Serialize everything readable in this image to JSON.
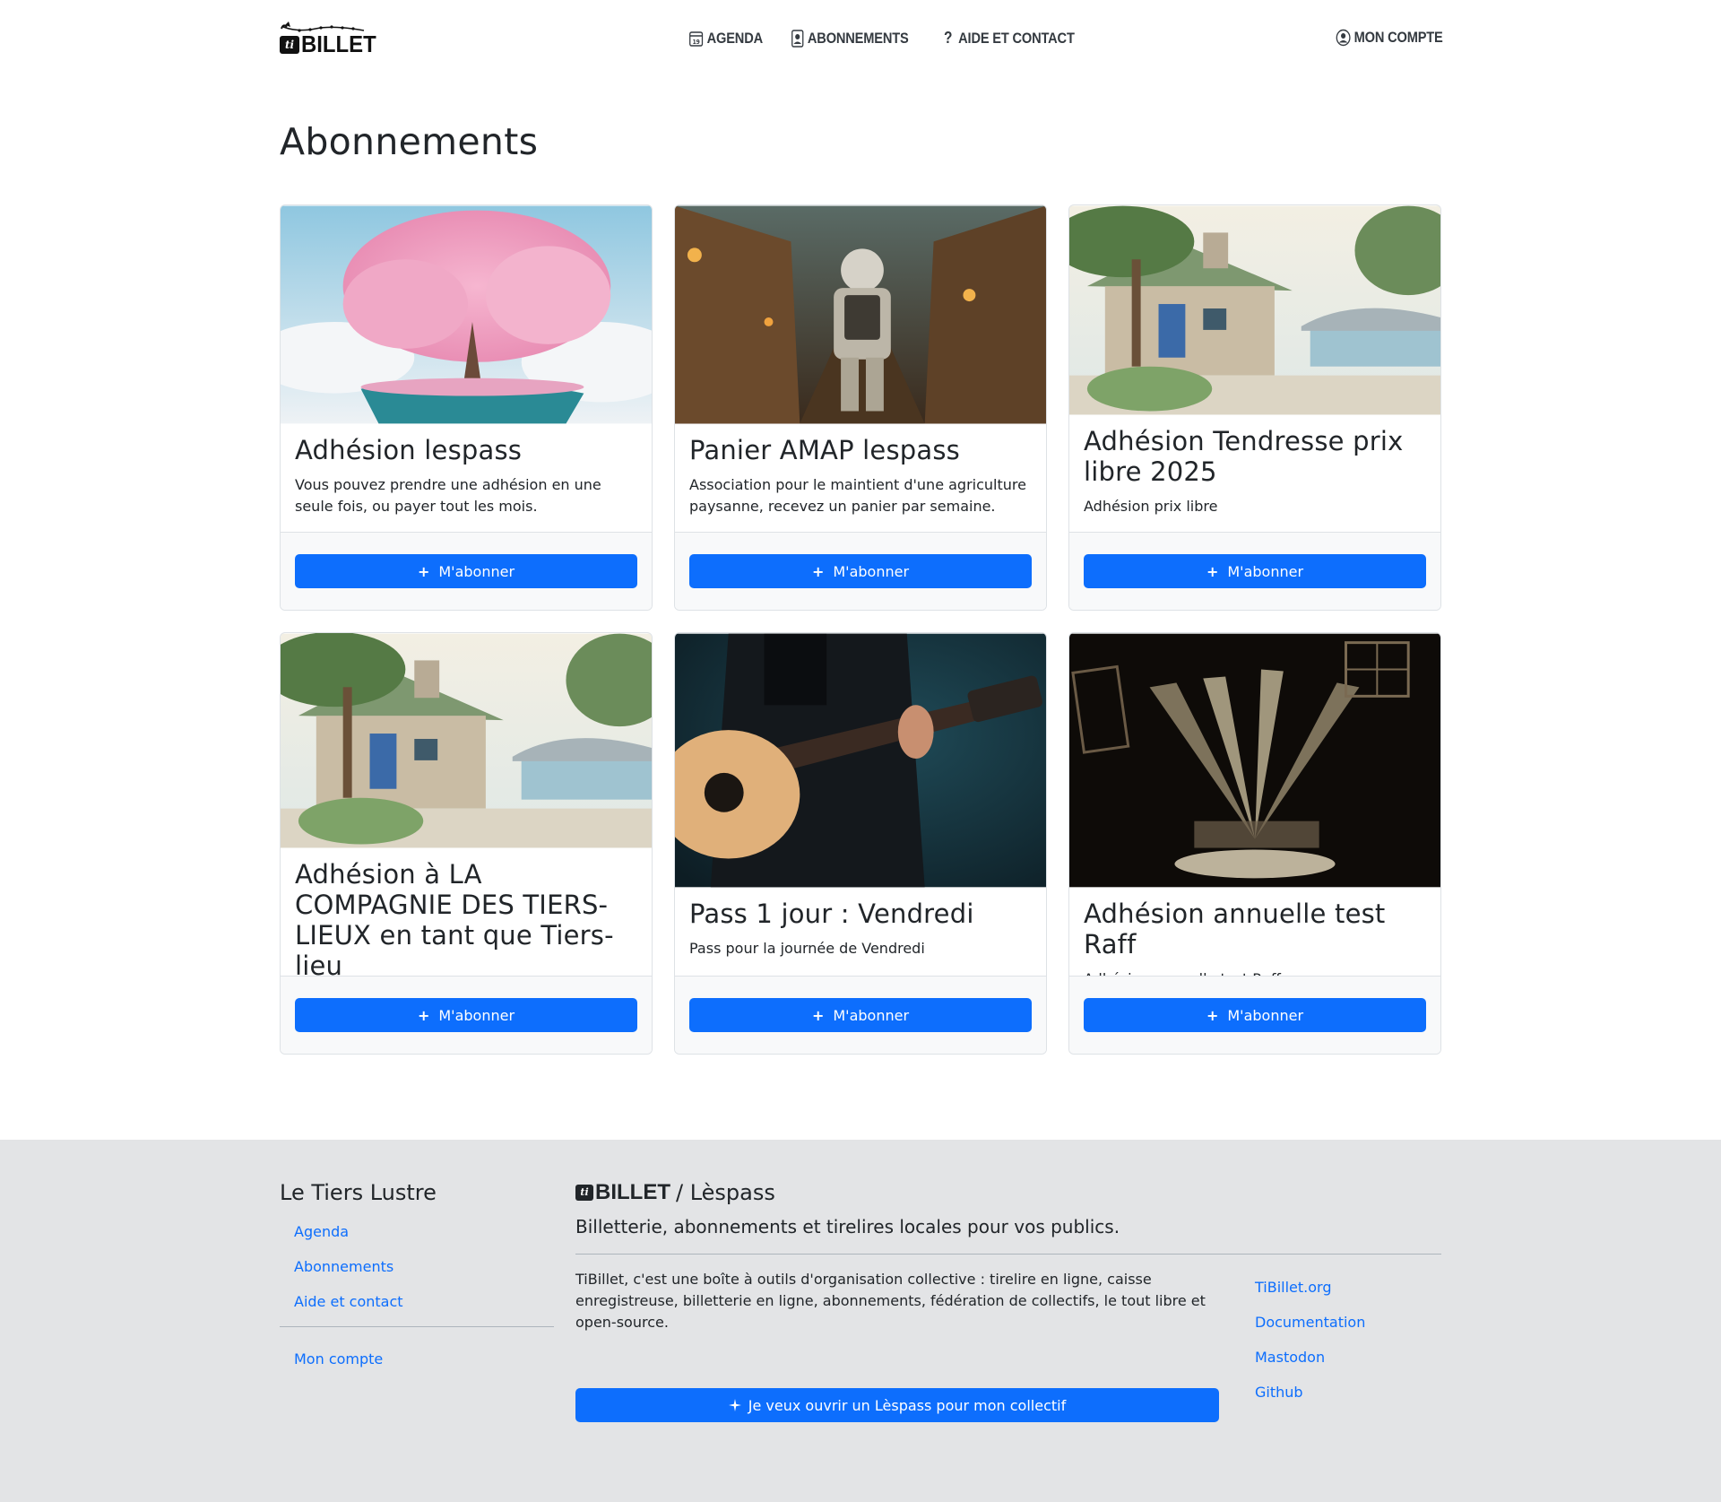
{
  "header": {
    "logo_text": "BILLET",
    "logo_ti": "ti",
    "nav": [
      {
        "label": "AGENDA",
        "icon": "calendar-icon"
      },
      {
        "label": "ABONNEMENTS",
        "icon": "badge-icon"
      },
      {
        "label": "AIDE ET CONTACT",
        "icon": "question-icon"
      }
    ],
    "account": {
      "label": "MON COMPTE",
      "icon": "user-circle-icon"
    }
  },
  "main": {
    "title": "Abonnements",
    "button_label": "M'abonner",
    "cards": [
      {
        "title": "Adhésion lespass",
        "text": "Vous pouvez prendre une adhésion en une seule fois, ou payer tout les mois.",
        "image": "cherry-blossom-tree-island"
      },
      {
        "title": "Panier AMAP lespass",
        "text": "Association pour le maintient d'une agriculture paysanne, recevez un panier par semaine.",
        "image": "astronaut-in-village-alley"
      },
      {
        "title": "Adhésion Tendresse prix libre 2025",
        "text": "Adhésion prix libre",
        "image": "stone-cottage-by-sea"
      },
      {
        "title": "Adhésion à LA COMPAGNIE DES TIERS-LIEUX en tant que Tiers-lieu",
        "text": "",
        "image": "stone-cottage-by-sea"
      },
      {
        "title": "Pass 1 jour : Vendredi",
        "text": "Pass pour la journée de Vendredi",
        "image": "guitarist-acoustic-guitar"
      },
      {
        "title": "Adhésion annuelle test Raff",
        "text": "Adhésion annuelle test Raff",
        "image": "stage-spotlights"
      }
    ]
  },
  "footer": {
    "site_name": "Le Tiers Lustre",
    "links": [
      "Agenda",
      "Abonnements",
      "Aide et contact"
    ],
    "account_link": "Mon compte",
    "brand_logo": "BILLET",
    "brand_ti": "ti",
    "brand_suffix": "/ Lèspass",
    "lead": "Billetterie, abonnements et tirelires locales pour vos publics.",
    "description": "TiBillet, c'est une boîte à outils d'organisation collective : tirelire en ligne, caisse enregistreuse, billetterie en ligne, abonnements, fédération de collectifs, le tout libre et open-source.",
    "cta": "Je veux ouvrir un Lèspass pour mon collectif",
    "external_links": [
      "TiBillet.org",
      "Documentation",
      "Mastodon",
      "Github"
    ]
  },
  "colors": {
    "primary": "#0d6efd",
    "footer_bg": "#e3e4e6",
    "card_footer_bg": "#f8f9fa"
  }
}
